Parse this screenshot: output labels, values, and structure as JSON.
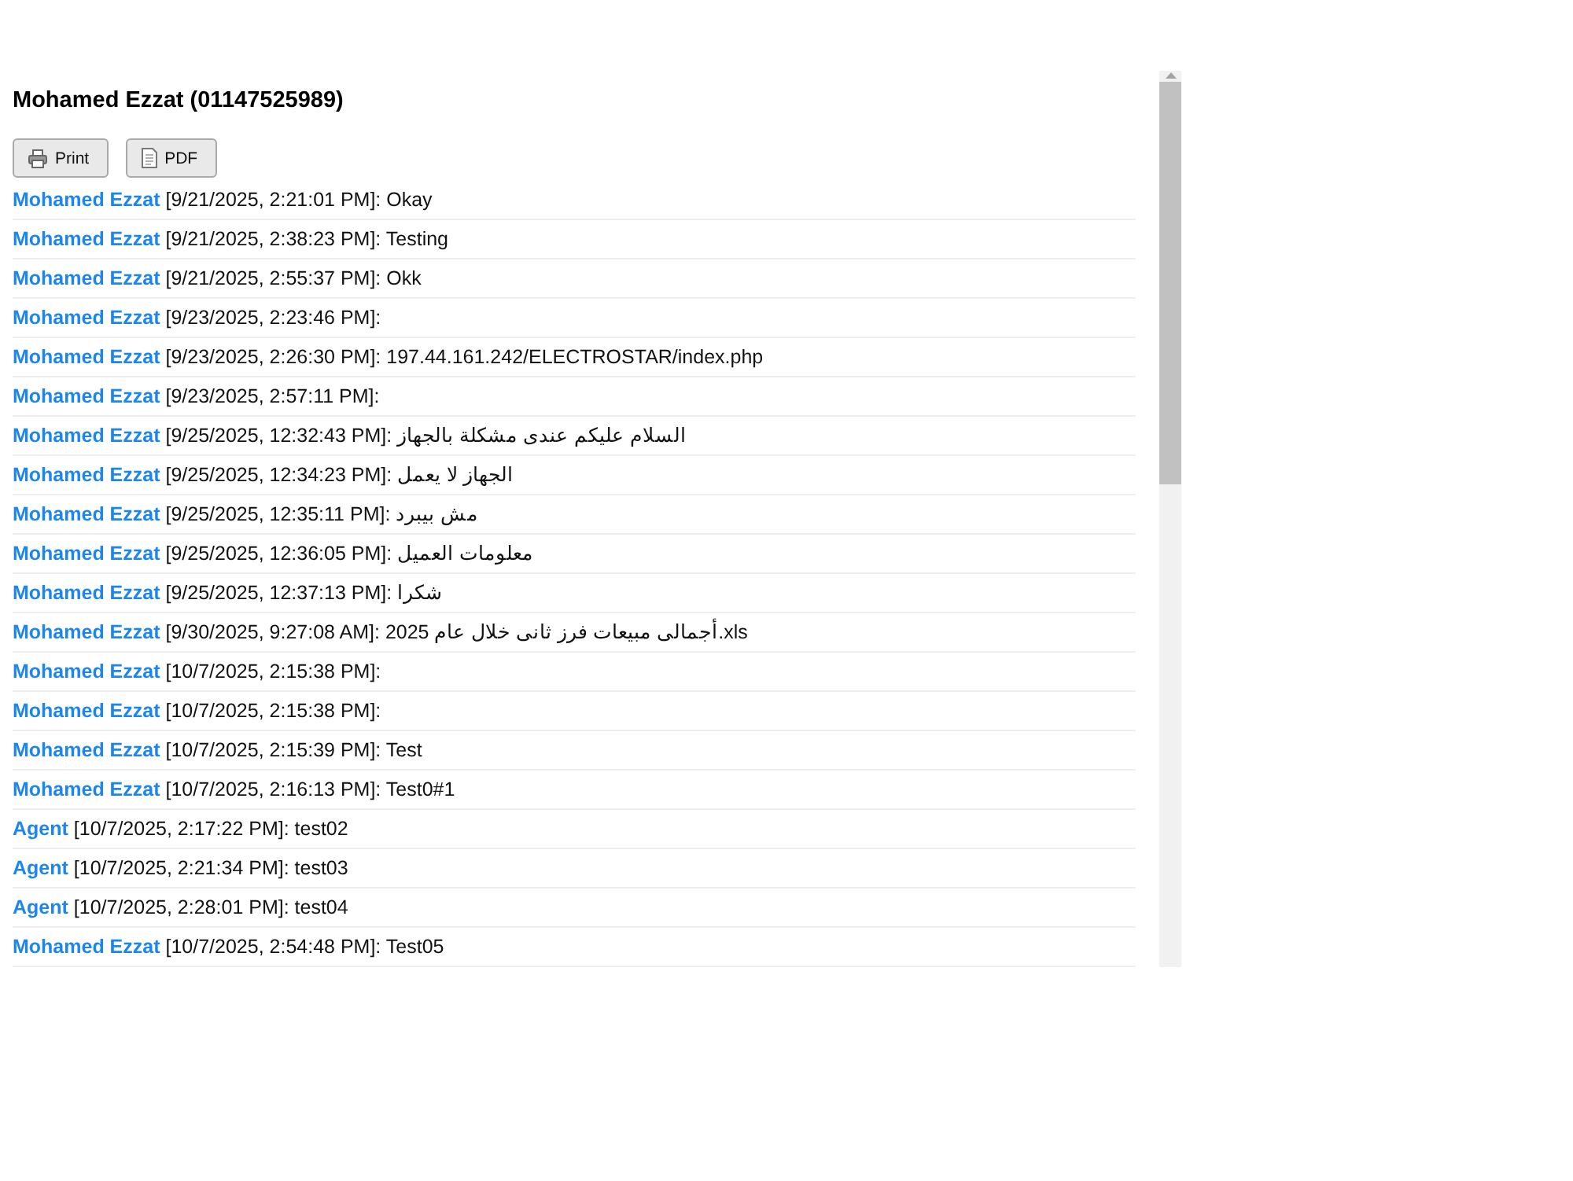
{
  "header": {
    "title": "Mohamed Ezzat (01147525989)"
  },
  "toolbar": {
    "buttons": [
      {
        "kind": "print",
        "label": "Print"
      },
      {
        "kind": "pdf",
        "label": "PDF"
      }
    ]
  },
  "messages": [
    {
      "sender": "Mohamed Ezzat",
      "message": "[9/21/2025, 2:21:01 PM]: Okay"
    },
    {
      "sender": "Mohamed Ezzat",
      "message": "[9/21/2025, 2:38:23 PM]: Testing"
    },
    {
      "sender": "Mohamed Ezzat",
      "message": "[9/21/2025, 2:55:37 PM]: Okk"
    },
    {
      "sender": "Mohamed Ezzat",
      "message": "[9/23/2025, 2:23:46 PM]:"
    },
    {
      "sender": "Mohamed Ezzat",
      "message": "[9/23/2025, 2:26:30 PM]: 197.44.161.242/ELECTROSTAR/index.php"
    },
    {
      "sender": "Mohamed Ezzat",
      "message": "[9/23/2025, 2:57:11 PM]:"
    },
    {
      "sender": "Mohamed Ezzat",
      "message": "[9/25/2025, 12:32:43 PM]: السلام عليكم عندى مشكلة بالجهاز"
    },
    {
      "sender": "Mohamed Ezzat",
      "message": "[9/25/2025, 12:34:23 PM]: الجهاز لا يعمل"
    },
    {
      "sender": "Mohamed Ezzat",
      "message": "[9/25/2025, 12:35:11 PM]: مش بيبرد"
    },
    {
      "sender": "Mohamed Ezzat",
      "message": "[9/25/2025, 12:36:05 PM]: معلومات العميل"
    },
    {
      "sender": "Mohamed Ezzat",
      "message": "[9/25/2025, 12:37:13 PM]: شكرا"
    },
    {
      "sender": "Mohamed Ezzat",
      "message": "[9/30/2025, 9:27:08 AM]: أجمالى مبيعات فرز ثانى خلال عام 2025.xls"
    },
    {
      "sender": "Mohamed Ezzat",
      "message": "[10/7/2025, 2:15:38 PM]:"
    },
    {
      "sender": "Mohamed Ezzat",
      "message": "[10/7/2025, 2:15:38 PM]:"
    },
    {
      "sender": "Mohamed Ezzat",
      "message": "[10/7/2025, 2:15:39 PM]: Test"
    },
    {
      "sender": "Mohamed Ezzat",
      "message": "[10/7/2025, 2:16:13 PM]: Test0#1"
    },
    {
      "sender": "Agent",
      "message": "[10/7/2025, 2:17:22 PM]: test02"
    },
    {
      "sender": "Agent",
      "message": "[10/7/2025, 2:21:34 PM]: test03"
    },
    {
      "sender": "Agent",
      "message": "[10/7/2025, 2:28:01 PM]: test04"
    },
    {
      "sender": "Mohamed Ezzat",
      "message": "[10/7/2025, 2:54:48 PM]: Test05"
    }
  ]
}
